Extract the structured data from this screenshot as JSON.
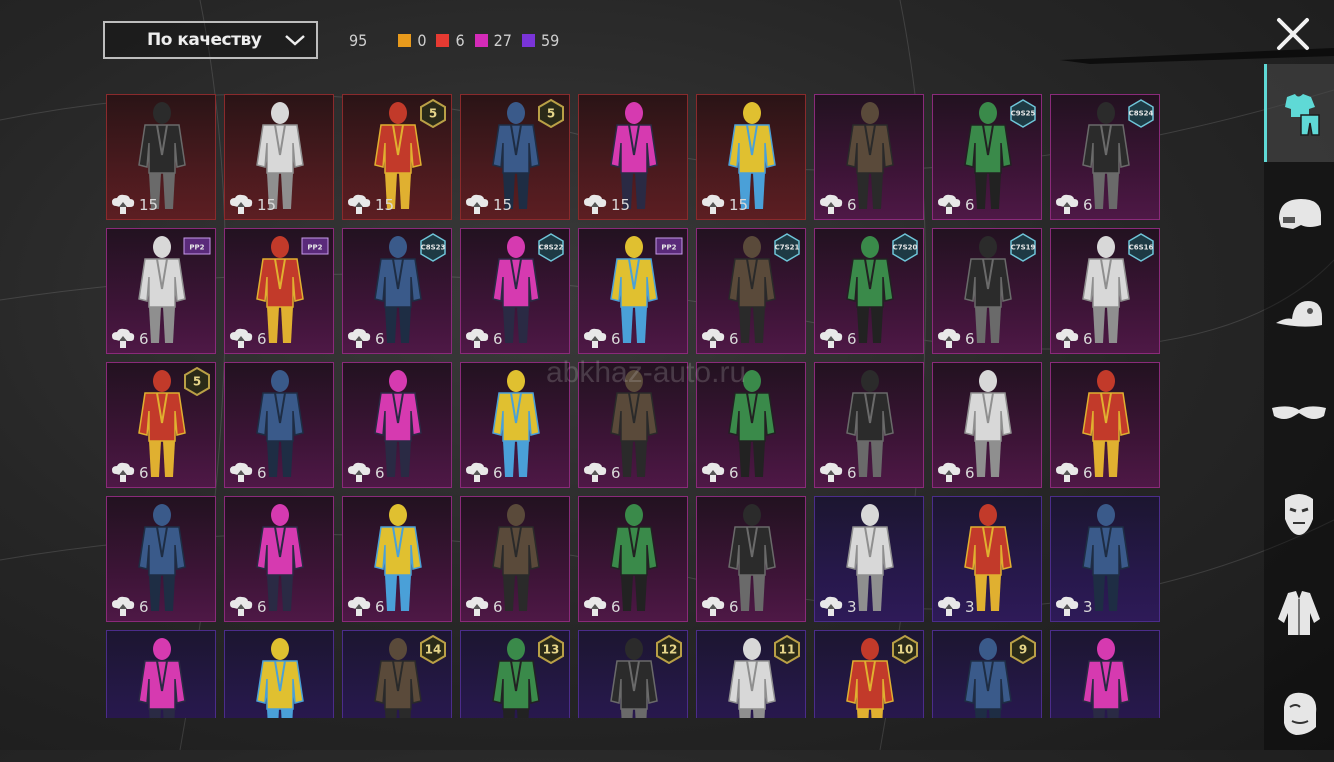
{
  "sort": {
    "label": "По качеству"
  },
  "counts": {
    "total": "95",
    "items": [
      {
        "color": "#e89a1c",
        "value": "0"
      },
      {
        "color": "#e63a32",
        "value": "6"
      },
      {
        "color": "#d42bb8",
        "value": "27"
      },
      {
        "color": "#7a34d8",
        "value": "59"
      }
    ]
  },
  "watermark": "abkhaz-auto.ru",
  "sidebar": {
    "items": [
      {
        "icon": "outfit-icon",
        "active": true
      },
      {
        "icon": "helmet-icon"
      },
      {
        "icon": "cap-icon"
      },
      {
        "icon": "glasses-icon"
      },
      {
        "icon": "mask-icon"
      },
      {
        "icon": "jacket-icon"
      },
      {
        "icon": "face-icon"
      }
    ]
  },
  "cards": [
    {
      "q": "red",
      "count": "15",
      "tag": ""
    },
    {
      "q": "red",
      "count": "15",
      "tag": ""
    },
    {
      "q": "red",
      "count": "15",
      "tag": "5"
    },
    {
      "q": "red",
      "count": "15",
      "tag": "5"
    },
    {
      "q": "red",
      "count": "15",
      "tag": ""
    },
    {
      "q": "red",
      "count": "15",
      "tag": ""
    },
    {
      "q": "pink",
      "count": "6",
      "tag": ""
    },
    {
      "q": "pink",
      "count": "6",
      "tag": "C9S25"
    },
    {
      "q": "pink",
      "count": "6",
      "tag": "C8S24"
    },
    {
      "q": "pink",
      "count": "6",
      "tag": "PP2"
    },
    {
      "q": "pink",
      "count": "6",
      "tag": "PP2"
    },
    {
      "q": "pink",
      "count": "6",
      "tag": "C8S23"
    },
    {
      "q": "pink",
      "count": "6",
      "tag": "C8S22"
    },
    {
      "q": "pink",
      "count": "6",
      "tag": "PP2"
    },
    {
      "q": "pink",
      "count": "6",
      "tag": "C7S21"
    },
    {
      "q": "pink",
      "count": "6",
      "tag": "C7S20"
    },
    {
      "q": "pink",
      "count": "6",
      "tag": "C7S19"
    },
    {
      "q": "pink",
      "count": "6",
      "tag": "C6S16"
    },
    {
      "q": "pink",
      "count": "6",
      "tag": "5"
    },
    {
      "q": "pink",
      "count": "6",
      "tag": ""
    },
    {
      "q": "pink",
      "count": "6",
      "tag": ""
    },
    {
      "q": "pink",
      "count": "6",
      "tag": ""
    },
    {
      "q": "pink",
      "count": "6",
      "tag": ""
    },
    {
      "q": "pink",
      "count": "6",
      "tag": ""
    },
    {
      "q": "pink",
      "count": "6",
      "tag": ""
    },
    {
      "q": "pink",
      "count": "6",
      "tag": ""
    },
    {
      "q": "pink",
      "count": "6",
      "tag": ""
    },
    {
      "q": "pink",
      "count": "6",
      "tag": ""
    },
    {
      "q": "pink",
      "count": "6",
      "tag": ""
    },
    {
      "q": "pink",
      "count": "6",
      "tag": ""
    },
    {
      "q": "pink",
      "count": "6",
      "tag": ""
    },
    {
      "q": "pink",
      "count": "6",
      "tag": ""
    },
    {
      "q": "pink",
      "count": "6",
      "tag": ""
    },
    {
      "q": "purple",
      "count": "3",
      "tag": ""
    },
    {
      "q": "purple",
      "count": "3",
      "tag": ""
    },
    {
      "q": "purple",
      "count": "3",
      "tag": ""
    },
    {
      "q": "purple",
      "count": "",
      "tag": ""
    },
    {
      "q": "purple",
      "count": "",
      "tag": ""
    },
    {
      "q": "purple",
      "count": "",
      "tag": "14"
    },
    {
      "q": "purple",
      "count": "",
      "tag": "13"
    },
    {
      "q": "purple",
      "count": "",
      "tag": "12"
    },
    {
      "q": "purple",
      "count": "",
      "tag": "11"
    },
    {
      "q": "purple",
      "count": "",
      "tag": "10"
    },
    {
      "q": "purple",
      "count": "",
      "tag": "9"
    },
    {
      "q": "purple",
      "count": "",
      "tag": ""
    }
  ]
}
